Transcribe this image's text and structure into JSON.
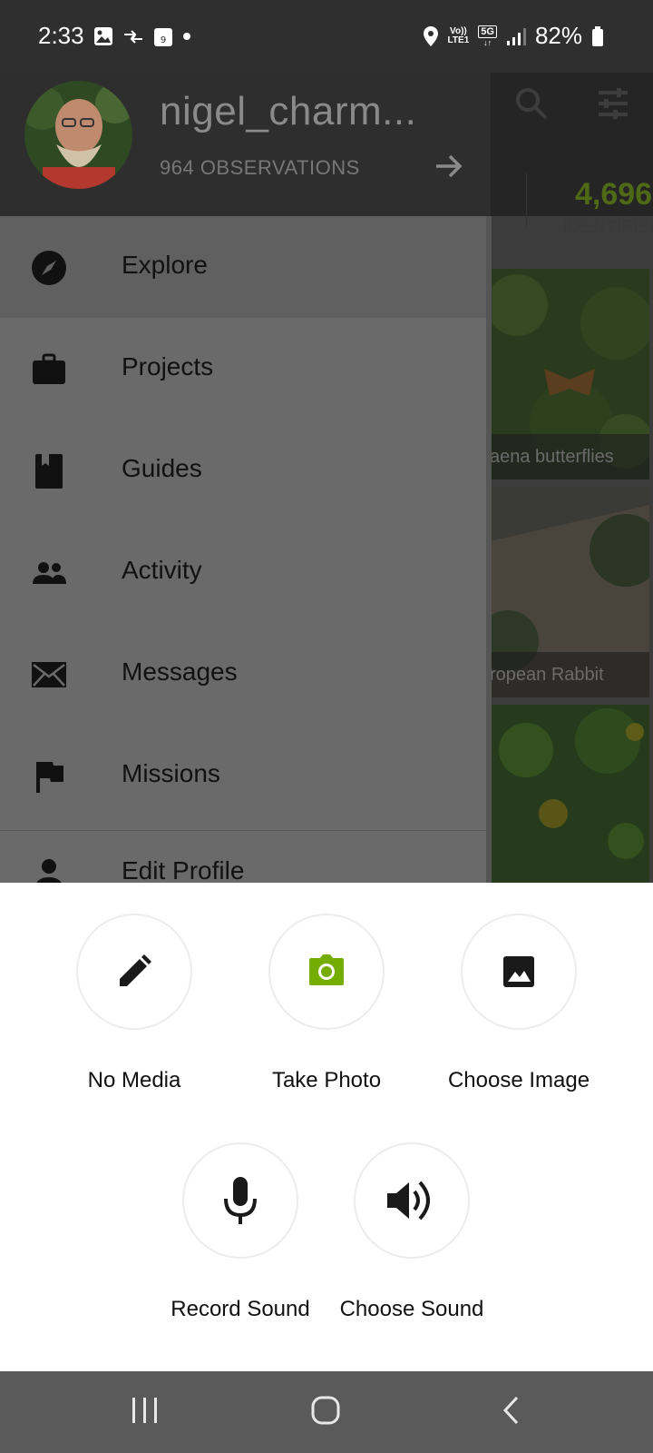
{
  "status_bar": {
    "time": "2:33",
    "battery": "82%",
    "network_top": "Vo))",
    "network_bottom": "LTE1",
    "gen": "5G"
  },
  "background": {
    "stat_number": "4,696",
    "stat_label": "IDENTIFIER",
    "tile_captions": [
      "aena butterflies",
      "ropean Rabbit",
      ""
    ]
  },
  "drawer": {
    "username": "nigel_charm...",
    "observations": "964 OBSERVATIONS",
    "items": [
      {
        "label": "Explore",
        "icon": "compass-icon"
      },
      {
        "label": "Projects",
        "icon": "briefcase-icon"
      },
      {
        "label": "Guides",
        "icon": "book-icon"
      },
      {
        "label": "Activity",
        "icon": "people-icon"
      },
      {
        "label": "Messages",
        "icon": "envelope-icon"
      },
      {
        "label": "Missions",
        "icon": "flag-icon"
      },
      {
        "label": "Edit Profile",
        "icon": "person-icon"
      }
    ]
  },
  "sheet": {
    "options": [
      {
        "label": "No Media",
        "icon": "pencil-icon"
      },
      {
        "label": "Take Photo",
        "icon": "camera-icon"
      },
      {
        "label": "Choose Image",
        "icon": "image-icon"
      },
      {
        "label": "Record Sound",
        "icon": "microphone-icon"
      },
      {
        "label": "Choose Sound",
        "icon": "speaker-icon"
      }
    ]
  },
  "colors": {
    "brand_green": "#74ac00",
    "sheet_bg": "#ffffff",
    "drawer_overlay": "#6a6a6a"
  }
}
